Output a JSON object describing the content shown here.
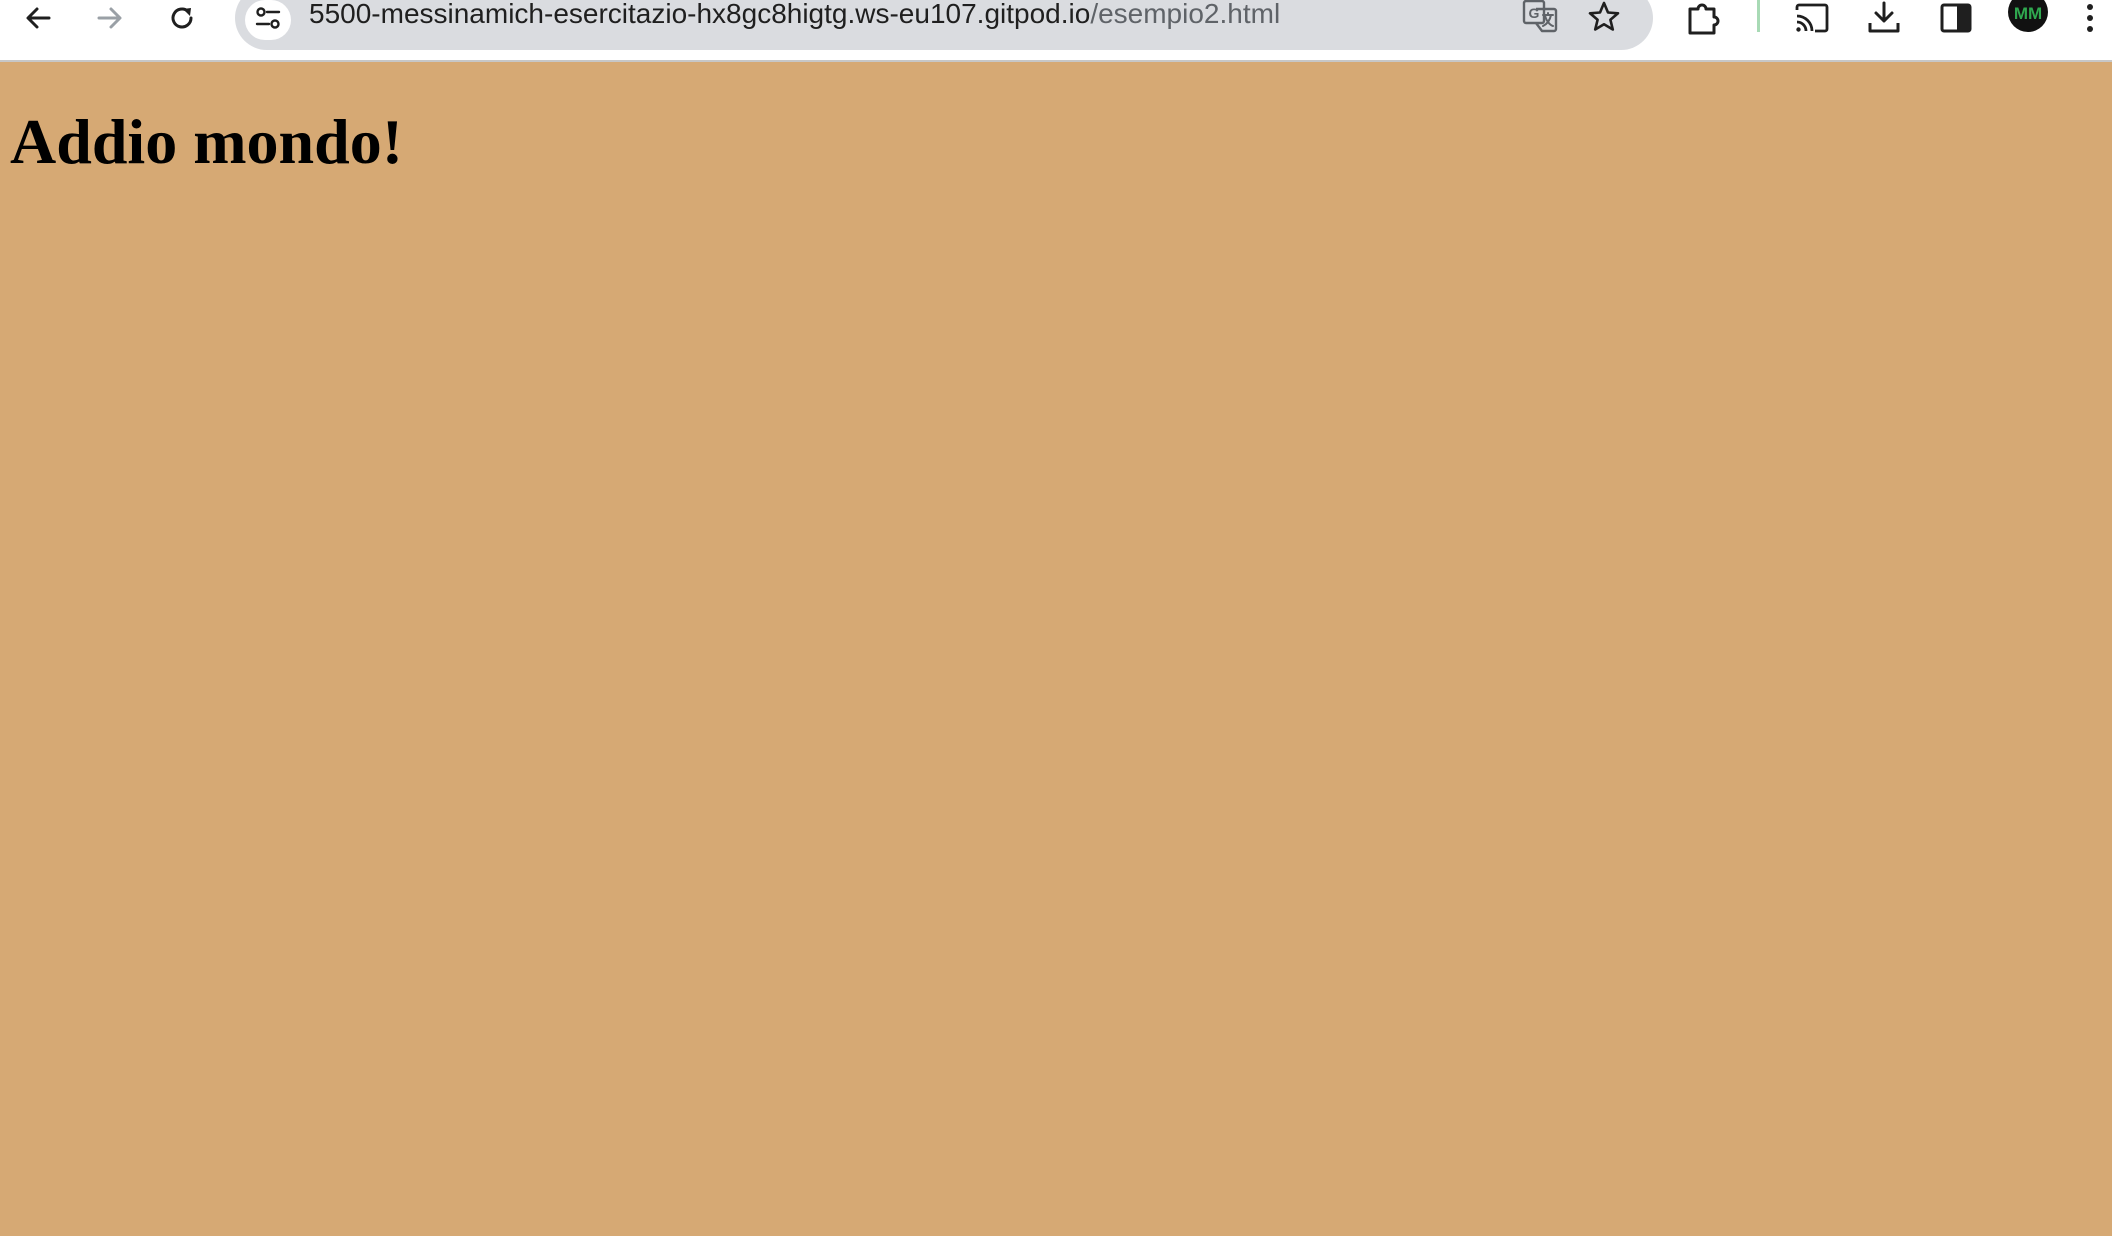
{
  "browser": {
    "url_host": "5500-messinamich-esercitazio-hx8gc8higtg.ws-eu107.gitpod.io",
    "url_path": "/esempio2.html",
    "profile_initials": "MM",
    "icons": {
      "back": "arrow-left-icon",
      "forward": "arrow-right-icon",
      "reload": "reload-icon",
      "site_info": "tune-icon",
      "translate": "translate-icon",
      "bookmark": "star-icon",
      "extensions": "puzzle-icon",
      "cast": "cast-icon",
      "downloads": "download-icon",
      "side_panel": "side-panel-icon",
      "menu": "kebab-menu-icon"
    },
    "colors": {
      "toolbar_bg": "#ffffff",
      "omnibox_bg": "#dadce0",
      "icon": "#1f1f1f",
      "icon_disabled": "#9aa0a6"
    }
  },
  "page": {
    "heading": "Addio mondo!",
    "background_color": "#d6a974"
  }
}
